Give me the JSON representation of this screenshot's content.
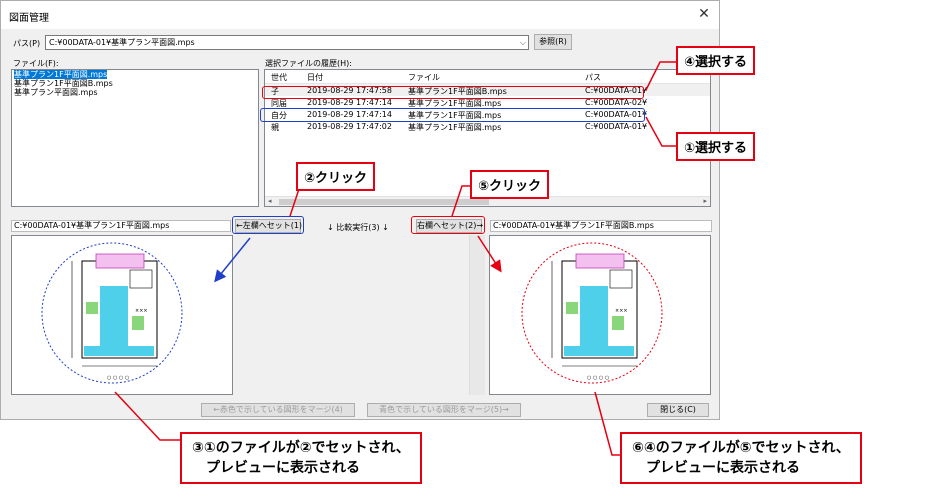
{
  "window": {
    "title": "図面管理",
    "close_glyph": "✕"
  },
  "path": {
    "label": "パス(P)",
    "value": "C:¥00DATA-01¥基準プラン平面図.mps",
    "browse_label": "参照(R)"
  },
  "files": {
    "label": "ファイル(F):",
    "items": [
      {
        "name": "基準プラン1F平面図.mps",
        "selected": true
      },
      {
        "name": "基準プラン1F平面図B.mps",
        "selected": false
      },
      {
        "name": "基準プラン平面図.mps",
        "selected": false
      }
    ]
  },
  "history": {
    "label": "選択ファイルの履歴(H):",
    "columns": [
      "世代",
      "日付",
      "ファイル",
      "パス"
    ],
    "rows": [
      {
        "gen": "子",
        "date": "2019-08-29 17:47:58",
        "file": "基準プラン1F平面図B.mps",
        "path": "C:¥00DATA-01¥"
      },
      {
        "gen": "同届",
        "date": "2019-08-29 17:47:14",
        "file": "基準プラン1F平面図.mps",
        "path": "C:¥00DATA-02¥"
      },
      {
        "gen": "自分",
        "date": "2019-08-29 17:47:14",
        "file": "基準プラン1F平面図.mps",
        "path": "C:¥00DATA-01¥"
      },
      {
        "gen": "親",
        "date": "2019-08-29 17:47:02",
        "file": "基準プラン1F平面図.mps",
        "path": "C:¥00DATA-01¥"
      }
    ]
  },
  "compare": {
    "left_path": "C:¥00DATA-01¥基準プラン1F平面図.mps",
    "right_path": "C:¥00DATA-01¥基準プラン1F平面図B.mps",
    "left_set_label": "←左欄へセット(1)",
    "run_label": "↓ 比較実行(3) ↓",
    "right_set_label": "右欄へセット(2)→"
  },
  "bottom": {
    "merge_red_label": "←赤色で示している図形をマージ(4)",
    "merge_blue_label": "青色で示している図形をマージ(5)→",
    "close_label": "閉じる(C)"
  },
  "annotations": {
    "step4": "④選択する",
    "step1": "①選択する",
    "step2": "②クリック",
    "step5": "⑤クリック",
    "step3_line1": "③①のファイルが②でセットされ、",
    "step3_line2": "プレビューに表示される",
    "step6_line1": "⑥④のファイルが⑤でセットされ、",
    "step6_line2": "プレビューに表示される"
  },
  "colors": {
    "callout_red": "#e60012",
    "highlight_blue": "#1f3fc8",
    "selection_blue": "#0078d7",
    "plan_cyan": "#4fd0ea"
  }
}
